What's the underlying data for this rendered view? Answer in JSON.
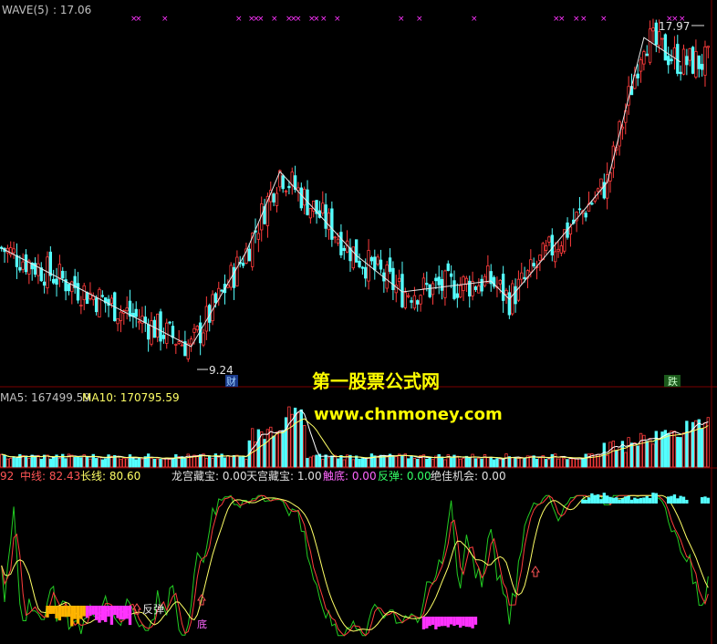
{
  "colors": {
    "bg": "#000000",
    "up": "#ff3c3c",
    "down": "#54ffff",
    "white": "#ffffff",
    "yellow": "#ffff00",
    "green": "#22cc22",
    "magenta": "#ff33ff",
    "orange": "#ffb400",
    "grid": "#7a0000",
    "label": "#c0c0c0"
  },
  "header": {
    "indicator": "WAVE(5)",
    "value": ": 17.06"
  },
  "price_panel": {
    "high_label": "17.97",
    "low_label": "9.24",
    "tags": [
      "财",
      "跌"
    ]
  },
  "watermark": {
    "title": "第一股票公式网",
    "url": "www.chnmoney.com"
  },
  "volume_panel": {
    "ma5_label": "MA5: 167499.59",
    "ma10_label": "MA10: 170795.59"
  },
  "indicator_panel": {
    "short_line": "92",
    "mid_line": "中线: 82.43",
    "long_line": "长线: 80.60",
    "longgong": "龙宫藏宝: 0.00",
    "tiangong": "天宫藏宝: 1.00",
    "chudi": "触底: 0.00",
    "fantan": "反弹: 0.00",
    "juejia": "绝佳机会: 0.00",
    "signal_fantan": "反弹",
    "signal_di": "底"
  },
  "chart_data": [
    {
      "type": "candlestick",
      "title": "WAVE(5)",
      "ylim": [
        8.5,
        18.5
      ],
      "annotations": [
        {
          "label": "17.97",
          "value": 17.97
        },
        {
          "label": "9.24",
          "value": 9.24
        }
      ],
      "wave_points": [
        {
          "i": 0,
          "v": 12.2
        },
        {
          "i": 62,
          "v": 9.5
        },
        {
          "i": 80,
          "v": 12.1
        },
        {
          "i": 91,
          "v": 14.3
        },
        {
          "i": 116,
          "v": 12.0
        },
        {
          "i": 131,
          "v": 11.0
        },
        {
          "i": 160,
          "v": 11.3
        },
        {
          "i": 166,
          "v": 10.8
        },
        {
          "i": 198,
          "v": 14.0
        },
        {
          "i": 210,
          "v": 17.97
        },
        {
          "i": 222,
          "v": 17.3
        }
      ]
    },
    {
      "type": "bar",
      "title": "Volume",
      "series": [
        {
          "name": "MA5",
          "value": 167499.59
        },
        {
          "name": "MA10",
          "value": 170795.59
        }
      ]
    },
    {
      "type": "line",
      "title": "Indicator",
      "series": [
        {
          "name": "中线",
          "last": 82.43
        },
        {
          "name": "长线",
          "last": 80.6
        }
      ],
      "ylim": [
        0,
        100
      ]
    }
  ]
}
